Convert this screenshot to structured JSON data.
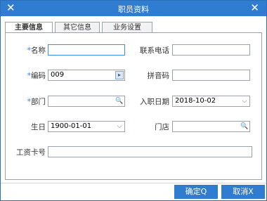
{
  "window": {
    "title": "职员资料"
  },
  "tabs": [
    {
      "label": "主要信息"
    },
    {
      "label": "其它信息"
    },
    {
      "label": "业务设置"
    }
  ],
  "form": {
    "name": {
      "label": "名称",
      "required_mark": "*",
      "value": ""
    },
    "phone": {
      "label": "联系电话",
      "value": ""
    },
    "code": {
      "label": "编码",
      "required_mark": "*",
      "value": "009"
    },
    "pinyin": {
      "label": "拼音码",
      "value": ""
    },
    "department": {
      "label": "部门",
      "required_mark": "*",
      "value": ""
    },
    "hire_date": {
      "label": "入职日期",
      "value": "2018-10-02"
    },
    "birthday": {
      "label": "生日",
      "value": "1900-01-01"
    },
    "store": {
      "label": "门店",
      "value": ""
    },
    "card_no": {
      "label": "工资卡号",
      "value": ""
    }
  },
  "footer": {
    "confirm_label": "确定Q",
    "cancel_label": "取消X"
  },
  "icons": {
    "window": "close-x-icon",
    "lookup": "lookup-icon",
    "search": "search-icon",
    "dropdown": "chevron-down-icon"
  },
  "colors": {
    "accent": "#2f7cd0"
  }
}
